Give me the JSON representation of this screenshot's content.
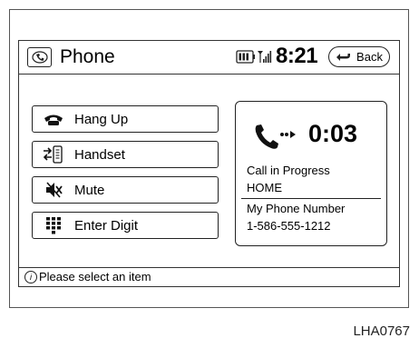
{
  "title": "Phone",
  "clock": "8:21",
  "back_label": "Back",
  "buttons": [
    {
      "label": "Hang Up",
      "icon": "hang-up-icon"
    },
    {
      "label": "Handset",
      "icon": "handset-icon"
    },
    {
      "label": "Mute",
      "icon": "mute-icon"
    },
    {
      "label": "Enter Digit",
      "icon": "keypad-icon"
    }
  ],
  "call": {
    "timer": "0:03",
    "status": "Call in Progress",
    "contact": "HOME",
    "my_number_label": "My Phone Number",
    "my_number": "1-586-555-1212"
  },
  "status_message": "Please select an item",
  "info_glyph": "i",
  "reference": "LHA0767"
}
